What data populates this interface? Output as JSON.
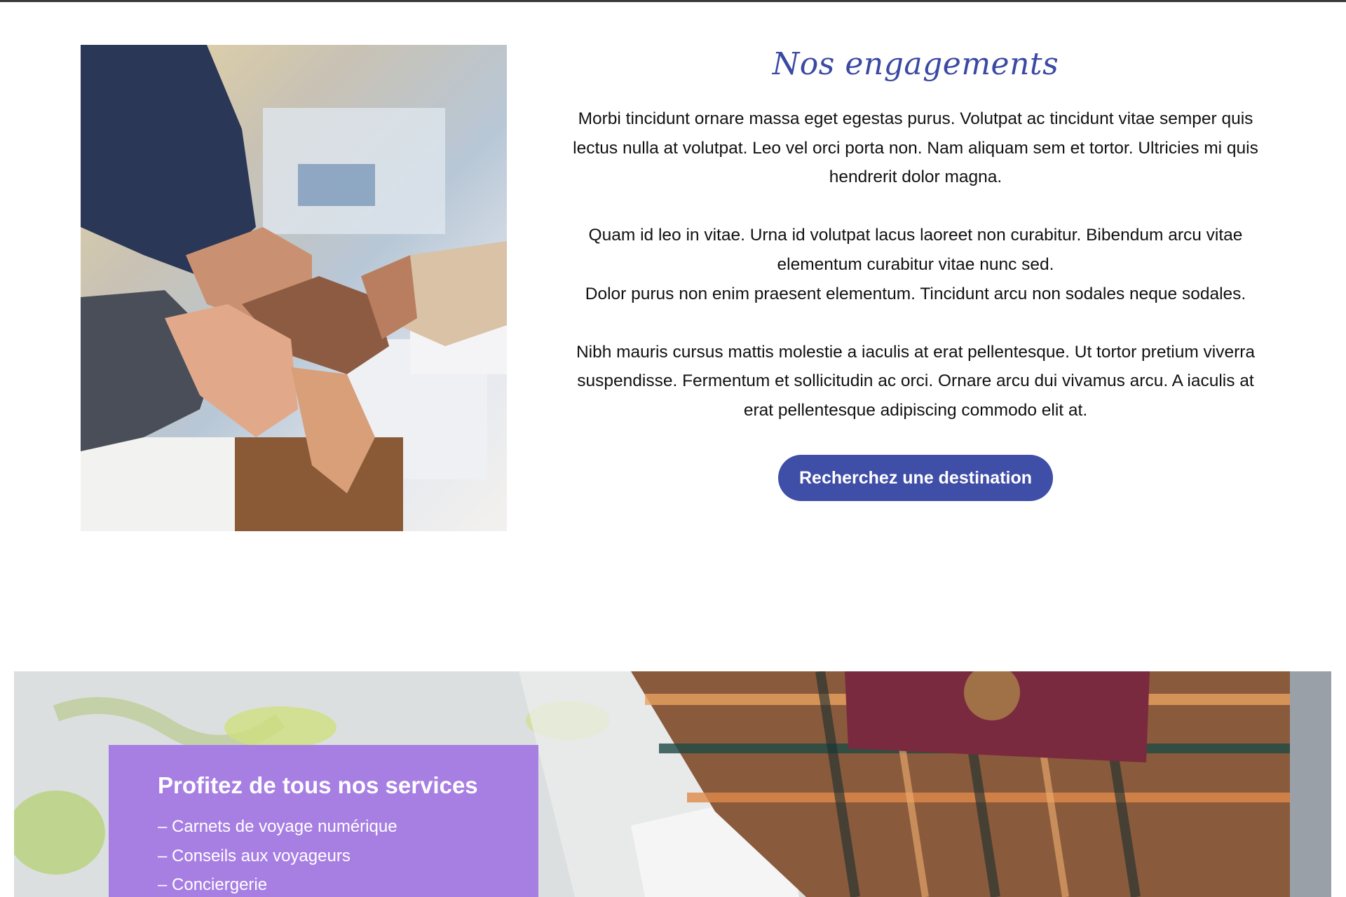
{
  "engagements": {
    "title": "Nos engagements",
    "paragraph1": "Morbi tincidunt ornare massa eget egestas purus. Volutpat ac tincidunt vitae semper quis lectus nulla at volutpat. Leo vel orci porta non. Nam aliquam sem et tortor. Ultricies mi quis hendrerit dolor magna.",
    "paragraph2a": "Quam id leo in vitae. Urna id volutpat lacus laoreet non curabitur. Bibendum arcu vitae elementum curabitur vitae nunc sed.",
    "paragraph2b": "Dolor purus non enim praesent elementum. Tincidunt arcu non sodales neque sodales.",
    "paragraph3": "Nibh mauris cursus mattis molestie a iaculis at erat pellentesque. Ut tortor pretium viverra suspendisse. Fermentum et sollicitudin ac orci. Ornare arcu dui vivamus arcu. A iaculis at erat pellentesque adipiscing commodo elit at.",
    "cta_label": "Recherchez une destination"
  },
  "services": {
    "title": "Profitez de tous nos services",
    "items": [
      "– Carnets de voyage numérique",
      "– Conseils aux voyageurs",
      "– Conciergerie"
    ]
  },
  "colors": {
    "accent": "#3f4ea6",
    "title": "#3a49a3",
    "services_box": "#a77fe3"
  },
  "images": {
    "team_photo": "joined-hands-photo",
    "banner_photo": "map-passport-suitcase-photo"
  }
}
